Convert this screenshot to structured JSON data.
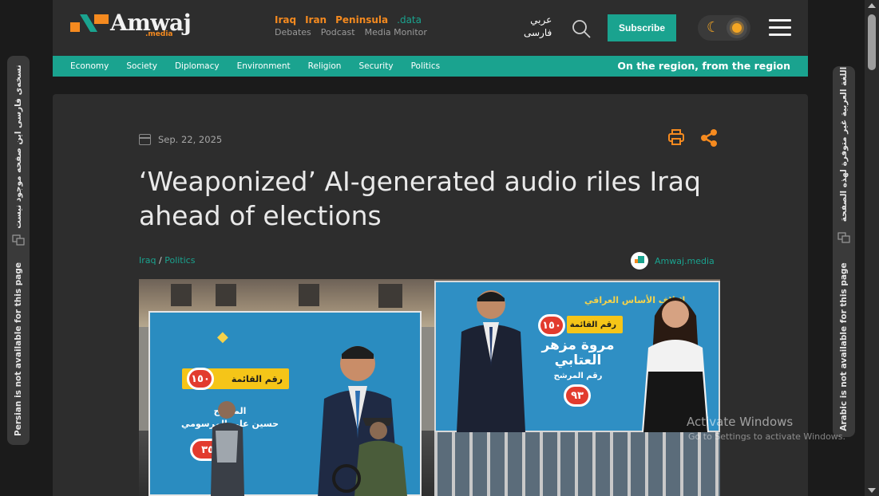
{
  "brand": {
    "name": "Amwaj",
    "sub": ".media"
  },
  "topnav": {
    "primary": [
      "Iraq",
      "Iran",
      "Peninsula",
      ".data"
    ],
    "secondary": [
      "Debates",
      "Podcast",
      "Media Monitor"
    ]
  },
  "languages": [
    "عربي",
    "فارسی"
  ],
  "subscribe_label": "Subscribe",
  "categories": [
    "Economy",
    "Society",
    "Diplomacy",
    "Environment",
    "Religion",
    "Security",
    "Politics"
  ],
  "tagline": "On the region, from the region",
  "side_left": {
    "english": "Persian is not available for this page",
    "native": "نسخه‌ی فارسی این صفحه موجود نیست"
  },
  "side_right": {
    "english": "Arabic is not available for this page",
    "native": "اللغة العربية غير متوفرة لهذه الصفحة"
  },
  "article": {
    "date": "Sep. 22, 2025",
    "title": "‘Weaponized’ AI-generated audio riles Iraq ahead of elections",
    "breadcrumb": [
      "Iraq",
      "Politics"
    ],
    "breadcrumb_sep": "/",
    "author": "Amwaj.media"
  },
  "hero_image": {
    "left_poster": {
      "list_label": "رقم القائمة",
      "list_number": "١٥٠",
      "name_line1": "المرشح",
      "name_line2": "حسين علي المرسومي",
      "candidate_number": "٣٥"
    },
    "right_poster": {
      "alliance": "ائتلاف الأساس العراقي",
      "list_label": "رقم القائمة",
      "list_number": "١٥٠",
      "name": "مروة مزهر العتابي",
      "candidate_label": "رقم المرشح",
      "candidate_number": "٩٣"
    }
  },
  "os_watermark": {
    "title": "Activate Windows",
    "subtitle": "Go to Settings to activate Windows."
  },
  "colors": {
    "accent": "#1aa38f",
    "orange": "#f58a1f",
    "card": "#2d2d2d",
    "background": "#1b1b1b"
  }
}
